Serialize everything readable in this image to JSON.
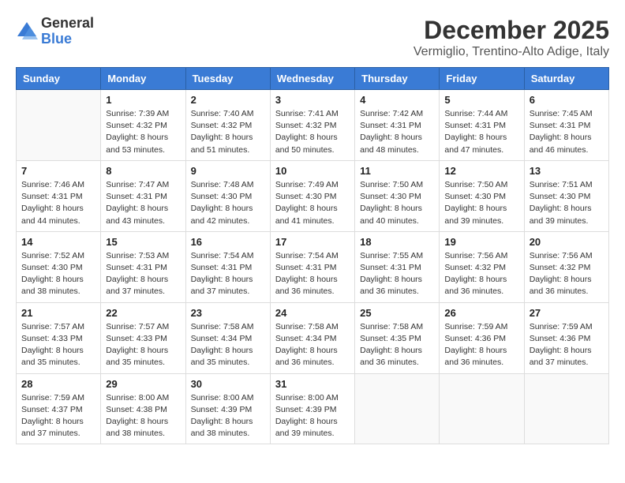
{
  "logo": {
    "general": "General",
    "blue": "Blue"
  },
  "title": {
    "month_year": "December 2025",
    "location": "Vermiglio, Trentino-Alto Adige, Italy"
  },
  "headers": [
    "Sunday",
    "Monday",
    "Tuesday",
    "Wednesday",
    "Thursday",
    "Friday",
    "Saturday"
  ],
  "weeks": [
    [
      {
        "day": "",
        "info": ""
      },
      {
        "day": "1",
        "info": "Sunrise: 7:39 AM\nSunset: 4:32 PM\nDaylight: 8 hours\nand 53 minutes."
      },
      {
        "day": "2",
        "info": "Sunrise: 7:40 AM\nSunset: 4:32 PM\nDaylight: 8 hours\nand 51 minutes."
      },
      {
        "day": "3",
        "info": "Sunrise: 7:41 AM\nSunset: 4:32 PM\nDaylight: 8 hours\nand 50 minutes."
      },
      {
        "day": "4",
        "info": "Sunrise: 7:42 AM\nSunset: 4:31 PM\nDaylight: 8 hours\nand 48 minutes."
      },
      {
        "day": "5",
        "info": "Sunrise: 7:44 AM\nSunset: 4:31 PM\nDaylight: 8 hours\nand 47 minutes."
      },
      {
        "day": "6",
        "info": "Sunrise: 7:45 AM\nSunset: 4:31 PM\nDaylight: 8 hours\nand 46 minutes."
      }
    ],
    [
      {
        "day": "7",
        "info": "Sunrise: 7:46 AM\nSunset: 4:31 PM\nDaylight: 8 hours\nand 44 minutes."
      },
      {
        "day": "8",
        "info": "Sunrise: 7:47 AM\nSunset: 4:31 PM\nDaylight: 8 hours\nand 43 minutes."
      },
      {
        "day": "9",
        "info": "Sunrise: 7:48 AM\nSunset: 4:30 PM\nDaylight: 8 hours\nand 42 minutes."
      },
      {
        "day": "10",
        "info": "Sunrise: 7:49 AM\nSunset: 4:30 PM\nDaylight: 8 hours\nand 41 minutes."
      },
      {
        "day": "11",
        "info": "Sunrise: 7:50 AM\nSunset: 4:30 PM\nDaylight: 8 hours\nand 40 minutes."
      },
      {
        "day": "12",
        "info": "Sunrise: 7:50 AM\nSunset: 4:30 PM\nDaylight: 8 hours\nand 39 minutes."
      },
      {
        "day": "13",
        "info": "Sunrise: 7:51 AM\nSunset: 4:30 PM\nDaylight: 8 hours\nand 39 minutes."
      }
    ],
    [
      {
        "day": "14",
        "info": "Sunrise: 7:52 AM\nSunset: 4:30 PM\nDaylight: 8 hours\nand 38 minutes."
      },
      {
        "day": "15",
        "info": "Sunrise: 7:53 AM\nSunset: 4:31 PM\nDaylight: 8 hours\nand 37 minutes."
      },
      {
        "day": "16",
        "info": "Sunrise: 7:54 AM\nSunset: 4:31 PM\nDaylight: 8 hours\nand 37 minutes."
      },
      {
        "day": "17",
        "info": "Sunrise: 7:54 AM\nSunset: 4:31 PM\nDaylight: 8 hours\nand 36 minutes."
      },
      {
        "day": "18",
        "info": "Sunrise: 7:55 AM\nSunset: 4:31 PM\nDaylight: 8 hours\nand 36 minutes."
      },
      {
        "day": "19",
        "info": "Sunrise: 7:56 AM\nSunset: 4:32 PM\nDaylight: 8 hours\nand 36 minutes."
      },
      {
        "day": "20",
        "info": "Sunrise: 7:56 AM\nSunset: 4:32 PM\nDaylight: 8 hours\nand 36 minutes."
      }
    ],
    [
      {
        "day": "21",
        "info": "Sunrise: 7:57 AM\nSunset: 4:33 PM\nDaylight: 8 hours\nand 35 minutes."
      },
      {
        "day": "22",
        "info": "Sunrise: 7:57 AM\nSunset: 4:33 PM\nDaylight: 8 hours\nand 35 minutes."
      },
      {
        "day": "23",
        "info": "Sunrise: 7:58 AM\nSunset: 4:34 PM\nDaylight: 8 hours\nand 35 minutes."
      },
      {
        "day": "24",
        "info": "Sunrise: 7:58 AM\nSunset: 4:34 PM\nDaylight: 8 hours\nand 36 minutes."
      },
      {
        "day": "25",
        "info": "Sunrise: 7:58 AM\nSunset: 4:35 PM\nDaylight: 8 hours\nand 36 minutes."
      },
      {
        "day": "26",
        "info": "Sunrise: 7:59 AM\nSunset: 4:36 PM\nDaylight: 8 hours\nand 36 minutes."
      },
      {
        "day": "27",
        "info": "Sunrise: 7:59 AM\nSunset: 4:36 PM\nDaylight: 8 hours\nand 37 minutes."
      }
    ],
    [
      {
        "day": "28",
        "info": "Sunrise: 7:59 AM\nSunset: 4:37 PM\nDaylight: 8 hours\nand 37 minutes."
      },
      {
        "day": "29",
        "info": "Sunrise: 8:00 AM\nSunset: 4:38 PM\nDaylight: 8 hours\nand 38 minutes."
      },
      {
        "day": "30",
        "info": "Sunrise: 8:00 AM\nSunset: 4:39 PM\nDaylight: 8 hours\nand 38 minutes."
      },
      {
        "day": "31",
        "info": "Sunrise: 8:00 AM\nSunset: 4:39 PM\nDaylight: 8 hours\nand 39 minutes."
      },
      {
        "day": "",
        "info": ""
      },
      {
        "day": "",
        "info": ""
      },
      {
        "day": "",
        "info": ""
      }
    ]
  ]
}
